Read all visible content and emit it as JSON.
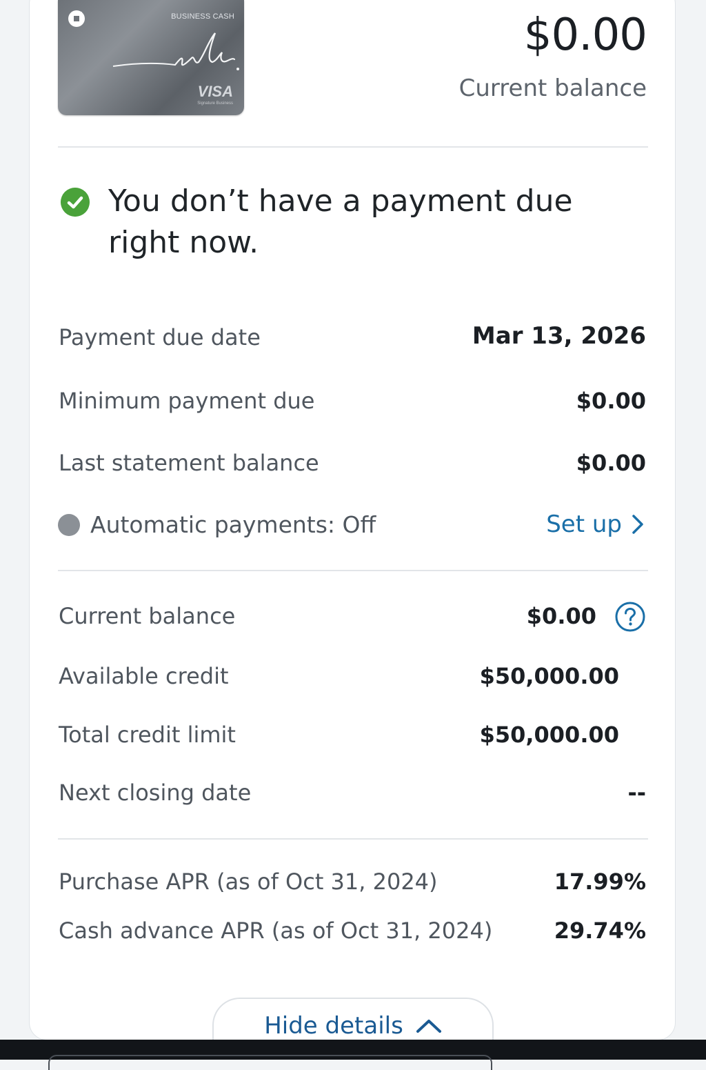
{
  "card": {
    "name": "BUSINESS CASH",
    "network": "VISA",
    "network_sub": "Signature Business"
  },
  "balance": {
    "amount": "$0.00",
    "label": "Current balance"
  },
  "status": {
    "message": "You don’t have a payment due right now."
  },
  "payment": {
    "due_date_label": "Payment due date",
    "due_date_value": "Mar 13, 2026",
    "min_label": "Minimum payment due",
    "min_value": "$0.00",
    "last_statement_label": "Last statement balance",
    "last_statement_value": "$0.00",
    "autopay_label": "Automatic payments: Off",
    "setup_label": "Set up"
  },
  "credit": {
    "current_balance_label": "Current balance",
    "current_balance_value": "$0.00",
    "available_label": "Available credit",
    "available_value": "$50,000.00",
    "limit_label": "Total credit limit",
    "limit_value": "$50,000.00",
    "closing_label": "Next closing date",
    "closing_value": "--"
  },
  "apr": {
    "purchase_label": "Purchase APR (as of Oct 31, 2024)",
    "purchase_value": "17.99%",
    "cash_label": "Cash advance APR (as of Oct 31, 2024)",
    "cash_value": "29.74%"
  },
  "actions": {
    "hide_details": "Hide details"
  },
  "colors": {
    "accent_link": "#1a6fa8",
    "success": "#4aa23a",
    "autopay_off": "#8b9096"
  }
}
